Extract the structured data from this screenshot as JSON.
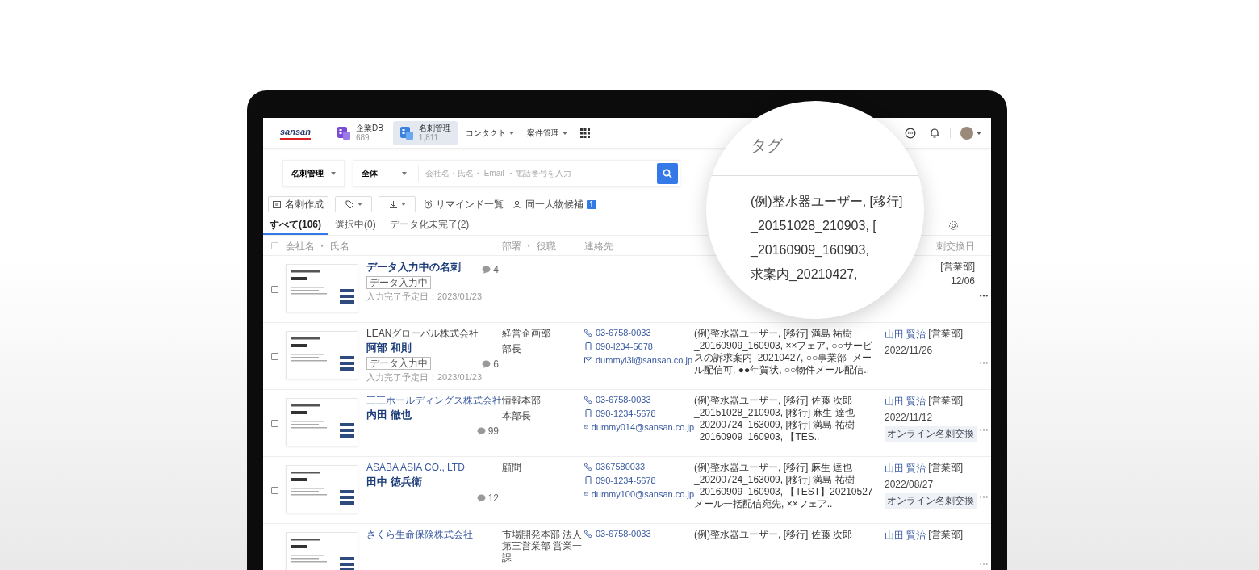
{
  "nav": {
    "logo": "sansan",
    "apps": [
      {
        "label": "企業DB",
        "count": "689",
        "selected": false
      },
      {
        "label": "名刺管理",
        "count": "1,811",
        "selected": true
      }
    ],
    "menus": [
      "コンタクト",
      "案件管理"
    ]
  },
  "search": {
    "scope": "名刺管理",
    "filter": "全体",
    "placeholder": "会社名・氏名・ Email ・電話番号を入力"
  },
  "toolbar": {
    "create": "名刺作成",
    "remind": "リマインド一覧",
    "duplicates": "同一人物候補",
    "duplicates_badge": "1"
  },
  "tabs": [
    {
      "label": "すべて(106)",
      "selected": true
    },
    {
      "label": "選択中(0)",
      "selected": false
    },
    {
      "label": "データ化未完了(2)",
      "selected": false
    }
  ],
  "columns": {
    "select_all_checked": false,
    "name": "会社名 ・ 氏名",
    "dept": "部署 ・ 役職",
    "contact": "連絡先",
    "exchange": "刺交換日"
  },
  "rows": [
    {
      "checked": false,
      "name": "データ入力中の名刺",
      "status": "データ入力中",
      "due": "入力完了予定日：2023/01/23",
      "comments": "4",
      "owner_dept": "[営業部]",
      "date": "12/06"
    },
    {
      "checked": false,
      "company": "LEANグローバル株式会社",
      "company_link": false,
      "name": "阿部 和則",
      "status": "データ入力中",
      "due": "入力完了予定日：2023/01/23",
      "comments": "6",
      "dept": "経営企画部",
      "title": "部長",
      "phone": "03-6758-0033",
      "mobile": "090-l234-5678",
      "email": "dummyl3l@sansan.co.jp",
      "tags": "(例)整水器ユーザー, [移行] 満島 祐樹 _20160909_160903, ××フェア, ○○サービスの訴求案内_20210427, ○○事業部_メール配信可, ●●年賀状, ○○物件メール配信..",
      "owner": "山田 賢治",
      "owner_dept": "[営業部]",
      "date": "2022/11/26"
    },
    {
      "checked": false,
      "company": "三三ホールディングス株式会社",
      "company_link": true,
      "name": "内田 徹也",
      "comments": "99",
      "dept": "情報本部",
      "title": "本部長",
      "phone": "03-6758-0033",
      "mobile": "090-1234-5678",
      "email": "dummy014@sansan.co.jp",
      "tags": "(例)整水器ユーザー, [移行] 佐藤 次郎 _20151028_210903, [移行] 麻生 達也 _20200724_163009, [移行] 満島 祐樹 _20160909_160903, 【TES..",
      "owner": "山田 賢治",
      "owner_dept": "[営業部]",
      "date": "2022/11/12",
      "exchange_tag": "オンライン名刺交換"
    },
    {
      "checked": false,
      "company": "ASABA ASIA CO., LTD",
      "company_link": true,
      "name": "田中 徳兵衛",
      "comments": "12",
      "dept": "顧問",
      "phone": "0367580033",
      "mobile": "090-1234-5678",
      "email": "dummy100@sansan.co.jp",
      "tags": "(例)整水器ユーザー, [移行] 麻生 達也 _20200724_163009, [移行] 満島 祐樹 _20160909_160903, 【TEST】20210527_メール一括配信宛先, ××フェア..",
      "owner": "山田 賢治",
      "owner_dept": "[営業部]",
      "date": "2022/08/27",
      "exchange_tag": "オンライン名刺交換"
    },
    {
      "company": "さくら生命保険株式会社",
      "company_link": true,
      "dept": "市場開発本部 法人第三営業部 営業一課",
      "phone": "03-6758-0033",
      "tags": "(例)整水器ユーザー, [移行] 佐藤 次郎",
      "owner": "山田 賢治",
      "owner_dept": "[営業部]"
    }
  ],
  "magnifier": {
    "header": "タグ",
    "lines": [
      "(例)整水器ユーザー, [移行]",
      "_20151028_210903, [",
      "_20160909_160903,",
      "求案内_20210427,"
    ]
  }
}
